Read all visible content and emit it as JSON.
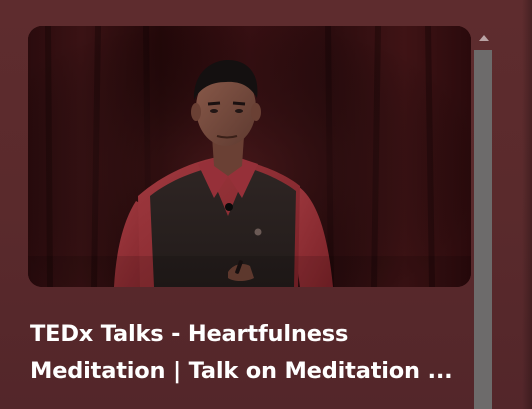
{
  "video_card": {
    "title": "TEDx Talks - Heartfulness Meditation | Talk on Meditation ...",
    "thumbnail_alt": "Speaker on stage in a maroon shirt and dark vest"
  },
  "colors": {
    "background": "#5a2a2c",
    "title_text": "#ffffff",
    "scroll_thumb": "#6d6b6b",
    "scroll_arrow": "#b9a3a4"
  },
  "icons": {
    "scroll_up": "triangle-up"
  }
}
